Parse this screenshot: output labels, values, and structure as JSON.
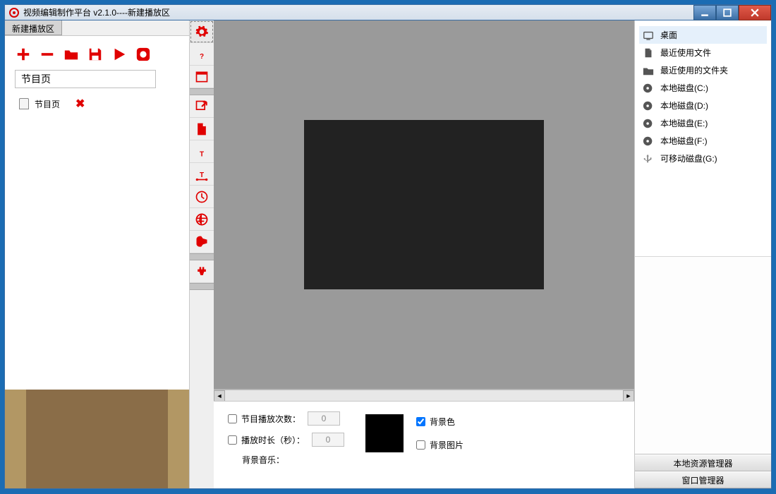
{
  "window": {
    "title": "视频编辑制作平台 v2.1.0----新建播放区"
  },
  "left": {
    "tab": "新建播放区",
    "name_input": "节目页",
    "page_item": "节目页"
  },
  "props": {
    "play_count_label": "节目播放次数：",
    "play_count_value": "0",
    "duration_label": "播放时长（秒）：",
    "duration_value": "0",
    "bgm_label": "背景音乐：",
    "bgcolor_label": "背景色",
    "bgimage_label": "背景图片"
  },
  "right": {
    "items": [
      {
        "icon": "monitor",
        "label": "桌面"
      },
      {
        "icon": "file",
        "label": "最近使用文件"
      },
      {
        "icon": "folder",
        "label": "最近使用的文件夹"
      },
      {
        "icon": "disk",
        "label": "本地磁盘(C:)"
      },
      {
        "icon": "disk",
        "label": "本地磁盘(D:)"
      },
      {
        "icon": "disk",
        "label": "本地磁盘(E:)"
      },
      {
        "icon": "disk",
        "label": "本地磁盘(F:)"
      },
      {
        "icon": "usb",
        "label": "可移动磁盘(G:)"
      }
    ],
    "btn_local": "本地资源管理器",
    "btn_window": "窗口管理器"
  }
}
